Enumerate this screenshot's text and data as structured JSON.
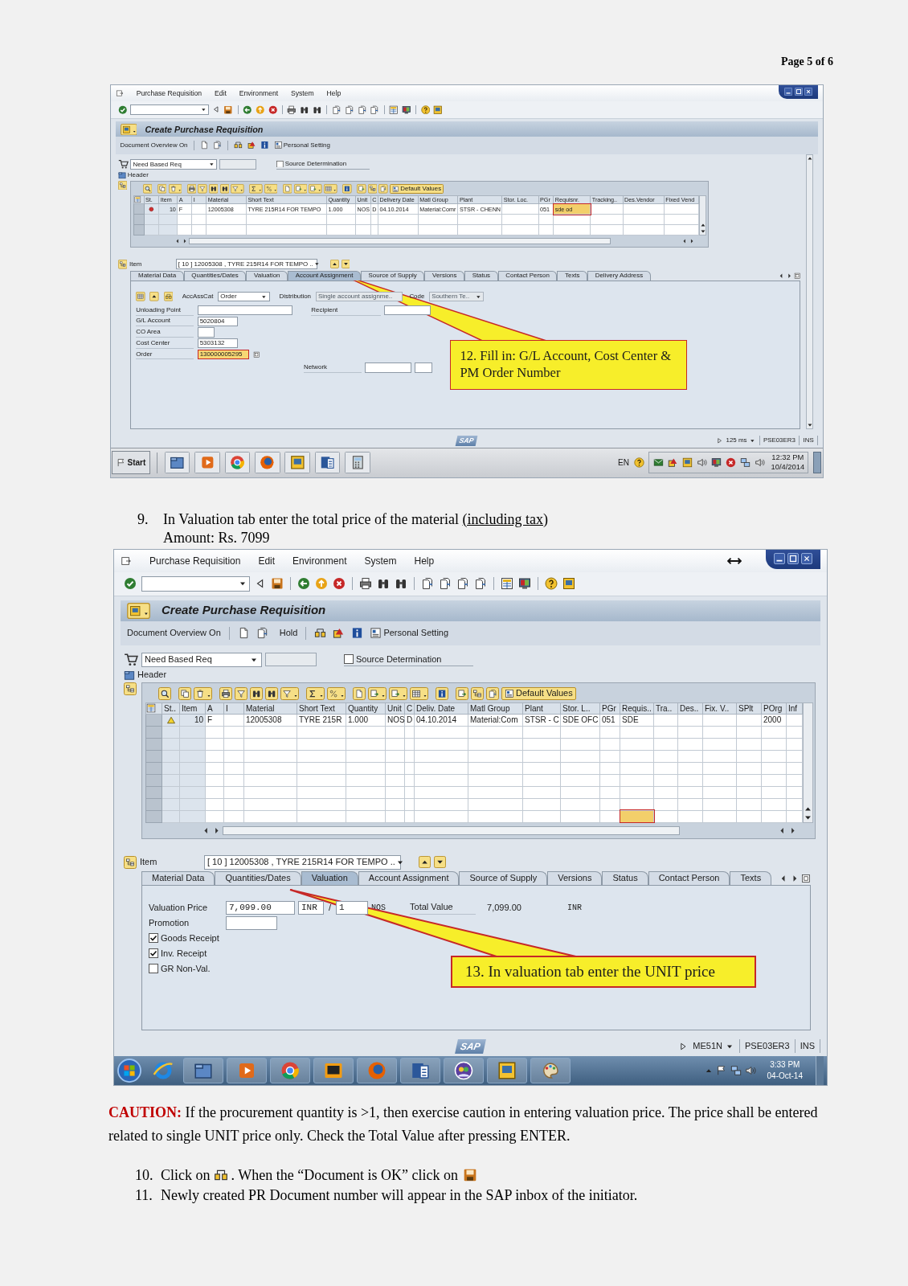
{
  "page_header": "Page 5 of 6",
  "screenshot_1": {
    "menu": [
      "Purchase Requisition",
      "Edit",
      "Environment",
      "System",
      "Help"
    ],
    "title": "Create Purchase Requisition",
    "app_toolbar": {
      "overview": "Document Overview On",
      "personal_setting": "Personal Setting"
    },
    "doc_type": "Need Based Req",
    "source_determination": {
      "label": "Source Determination",
      "checked": false
    },
    "header_label": "Header",
    "default_values": "Default Values",
    "table": {
      "focus_in_data_row": true,
      "columns": [
        {
          "label": "St.",
          "focused": false
        },
        {
          "label": "Item",
          "focused": false
        },
        {
          "label": "A",
          "focused": false
        },
        {
          "label": "I",
          "focused": false
        },
        {
          "label": "Material",
          "focused": false
        },
        {
          "label": "Short Text",
          "focused": false
        },
        {
          "label": "Quantity",
          "focused": false
        },
        {
          "label": "Unit",
          "focused": false
        },
        {
          "label": "C",
          "focused": false
        },
        {
          "label": "Delivery Date",
          "focused": false
        },
        {
          "label": "Matl Group",
          "focused": false
        },
        {
          "label": "Plant",
          "focused": false
        },
        {
          "label": "Stor. Loc.",
          "focused": false
        },
        {
          "label": "PGr",
          "focused": false
        },
        {
          "label": "Requisnr.",
          "focused": true
        },
        {
          "label": "Tracking..",
          "focused": false
        },
        {
          "label": "Des.Vendor",
          "focused": false
        },
        {
          "label": "Fixed Vend",
          "focused": false
        }
      ],
      "rows": [
        {
          "kind": "error",
          "cells": [
            null,
            "10",
            "F",
            null,
            "12005308",
            "TYRE 215R14 FOR TEMPO",
            "1.000",
            "NOS",
            "D",
            "04.10.2014",
            "Material:Comr",
            "STSR - CHENN",
            null,
            "051",
            "sde od",
            null,
            null,
            null
          ]
        }
      ]
    },
    "item": {
      "label": "Item",
      "value": "[ 10 ] 12005308 , TYRE 215R14 FOR TEMPO .."
    },
    "tabs": [
      {
        "label": "Material Data",
        "selected": false
      },
      {
        "label": "Quantities/Dates",
        "selected": false
      },
      {
        "label": "Valuation",
        "selected": false
      },
      {
        "label": "Account Assignment",
        "selected": true
      },
      {
        "label": "Source of Supply",
        "selected": false
      },
      {
        "label": "Versions",
        "selected": false
      },
      {
        "label": "Status",
        "selected": false
      },
      {
        "label": "Contact Person",
        "selected": false
      },
      {
        "label": "Texts",
        "selected": false
      },
      {
        "label": "Delivery Address",
        "selected": false
      }
    ],
    "tab_content": {
      "kind": "account_assignment",
      "acc_ass_cat": {
        "label": "AccAssCat",
        "value": "Order"
      },
      "distribution": {
        "label": "Distribution",
        "value": "Single account assignme..",
        "disabled": true
      },
      "code": {
        "label": "Code",
        "value": "Southern Te.."
      },
      "fields": [
        {
          "label": "Unloading Point",
          "focused": false
        },
        {
          "label": "G/L Account",
          "value": "5020804",
          "focused": false
        },
        {
          "label": "CO Area",
          "focused": false
        },
        {
          "label": "Cost Center",
          "value": "5303132",
          "focused": false
        },
        {
          "label": "Order",
          "value": "130000005295",
          "focused": true
        }
      ],
      "recipient": {
        "label": "Recipient"
      },
      "network": {
        "label": "Network"
      }
    },
    "callout": "12. Fill in: G/L Account, Cost Center & PM Order Number",
    "logo": "SAP",
    "status_bar": [
      {
        "text": "125 ms",
        "dropdown": true
      },
      {
        "text": "PSE03ER3",
        "dropdown": false
      },
      {
        "text": "INS",
        "dropdown": false
      }
    ],
    "taskbar": {
      "kind": "classic",
      "start": "Start",
      "language": "EN",
      "time": "12:32 PM",
      "date": "10/4/2014"
    }
  },
  "step_9": {
    "number": "9.",
    "segments": [
      {
        "text": "In Valuation tab enter the total price of the material ",
        "underline": false
      },
      {
        "text": "(including tax)",
        "underline": true
      }
    ],
    "detail": "Amount: Rs. 7099"
  },
  "screenshot_2": {
    "menu": [
      "Purchase Requisition",
      "Edit",
      "Environment",
      "System",
      "Help"
    ],
    "title": "Create Purchase Requisition",
    "app_toolbar": {
      "overview": "Document Overview On",
      "hold": "Hold",
      "personal_setting": "Personal Setting"
    },
    "doc_type": "Need Based Req",
    "source_determination": {
      "label": "Source Determination",
      "checked": false
    },
    "header_label": "Header",
    "default_values": "Default Values",
    "table": {
      "focus_in_data_row": false,
      "columns": [
        {
          "label": "St..",
          "focused": false
        },
        {
          "label": "Item",
          "focused": false
        },
        {
          "label": "A",
          "focused": false
        },
        {
          "label": "I",
          "focused": false
        },
        {
          "label": "Material",
          "focused": false
        },
        {
          "label": "Short Text",
          "focused": false
        },
        {
          "label": "Quantity",
          "focused": false
        },
        {
          "label": "Unit",
          "focused": false
        },
        {
          "label": "C",
          "focused": false
        },
        {
          "label": "Deliv. Date",
          "focused": false
        },
        {
          "label": "Matl Group",
          "focused": false
        },
        {
          "label": "Plant",
          "focused": false
        },
        {
          "label": "Stor. L..",
          "focused": false
        },
        {
          "label": "PGr",
          "focused": false
        },
        {
          "label": "Requis..",
          "focused": true
        },
        {
          "label": "Tra..",
          "focused": false
        },
        {
          "label": "Des..",
          "focused": false
        },
        {
          "label": "Fix. V..",
          "focused": false
        },
        {
          "label": "SPlt",
          "focused": false
        },
        {
          "label": "POrg",
          "focused": false
        },
        {
          "label": "Inf",
          "focused": false
        }
      ],
      "rows": [
        {
          "kind": "warning",
          "cells": [
            null,
            "10",
            "F",
            null,
            "12005308",
            "TYRE 215R",
            "1.000",
            "NOS",
            "D",
            "04.10.2014",
            "Material:Com",
            "STSR - C",
            "SDE OFC",
            "051",
            "SDE",
            null,
            null,
            null,
            null,
            "2000",
            null
          ]
        }
      ]
    },
    "item": {
      "label": "Item",
      "value": "[ 10 ] 12005308 , TYRE 215R14 FOR TEMPO .."
    },
    "tabs": [
      {
        "label": "Material Data",
        "selected": false
      },
      {
        "label": "Quantities/Dates",
        "selected": false
      },
      {
        "label": "Valuation",
        "selected": true
      },
      {
        "label": "Account Assignment",
        "selected": false
      },
      {
        "label": "Source of Supply",
        "selected": false
      },
      {
        "label": "Versions",
        "selected": false
      },
      {
        "label": "Status",
        "selected": false
      },
      {
        "label": "Contact Person",
        "selected": false
      },
      {
        "label": "Texts",
        "selected": false
      }
    ],
    "tab_content": {
      "kind": "valuation",
      "price": {
        "label": "Valuation Price",
        "value": "7,099.00",
        "currency": "INR",
        "per": "/",
        "quantity": "1",
        "unit": "NOS"
      },
      "total": {
        "label": "Total Value",
        "value": "7,099.00",
        "currency": "INR"
      },
      "promotion": {
        "label": "Promotion"
      },
      "checkboxes": [
        {
          "label": "Goods Receipt",
          "checked": true
        },
        {
          "label": "Inv. Receipt",
          "checked": true
        },
        {
          "label": "GR Non-Val.",
          "checked": false
        }
      ]
    },
    "callout": "13. In valuation tab enter the UNIT price",
    "logo": "SAP",
    "status_bar": [
      {
        "text": "ME51N",
        "dropdown": true
      },
      {
        "text": "PSE03ER3",
        "dropdown": false
      },
      {
        "text": "INS",
        "dropdown": false
      }
    ],
    "taskbar": {
      "kind": "win7",
      "time": "3:33 PM",
      "date": "04-Oct-14"
    }
  },
  "caution": {
    "label": "CAUTION:",
    "text": "If the procurement quantity is >1, then exercise caution in entering valuation price. The price shall be entered related to single UNIT price only. Check the Total Value after pressing ENTER."
  },
  "steps": [
    {
      "number": "10.",
      "texts": [
        "Click on",
        ". When the “Document is OK” click on"
      ]
    },
    {
      "number": "11.",
      "texts": [
        "Newly created PR Document number will appear in the SAP inbox of the initiator."
      ]
    }
  ]
}
